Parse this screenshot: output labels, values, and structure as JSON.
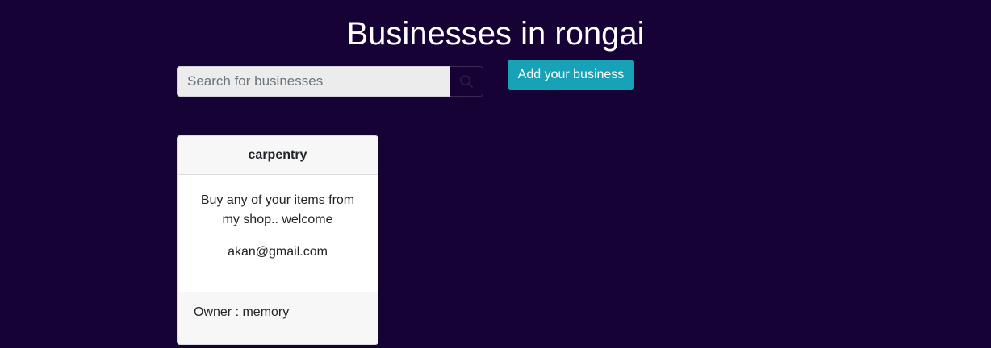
{
  "header": {
    "title": "Businesses in rongai"
  },
  "search": {
    "placeholder": "Search for businesses",
    "value": "",
    "button_icon": "search-icon"
  },
  "actions": {
    "add_business_label": "Add your business"
  },
  "colors": {
    "background": "#170235",
    "accent": "#17a2b8",
    "card_background": "#ffffff",
    "card_header_background": "#f7f7f7"
  },
  "businesses": [
    {
      "name": "carpentry",
      "description": "Buy any of your items from my shop.. welcome",
      "email": "akan@gmail.com",
      "owner_label": "Owner : memory"
    }
  ]
}
